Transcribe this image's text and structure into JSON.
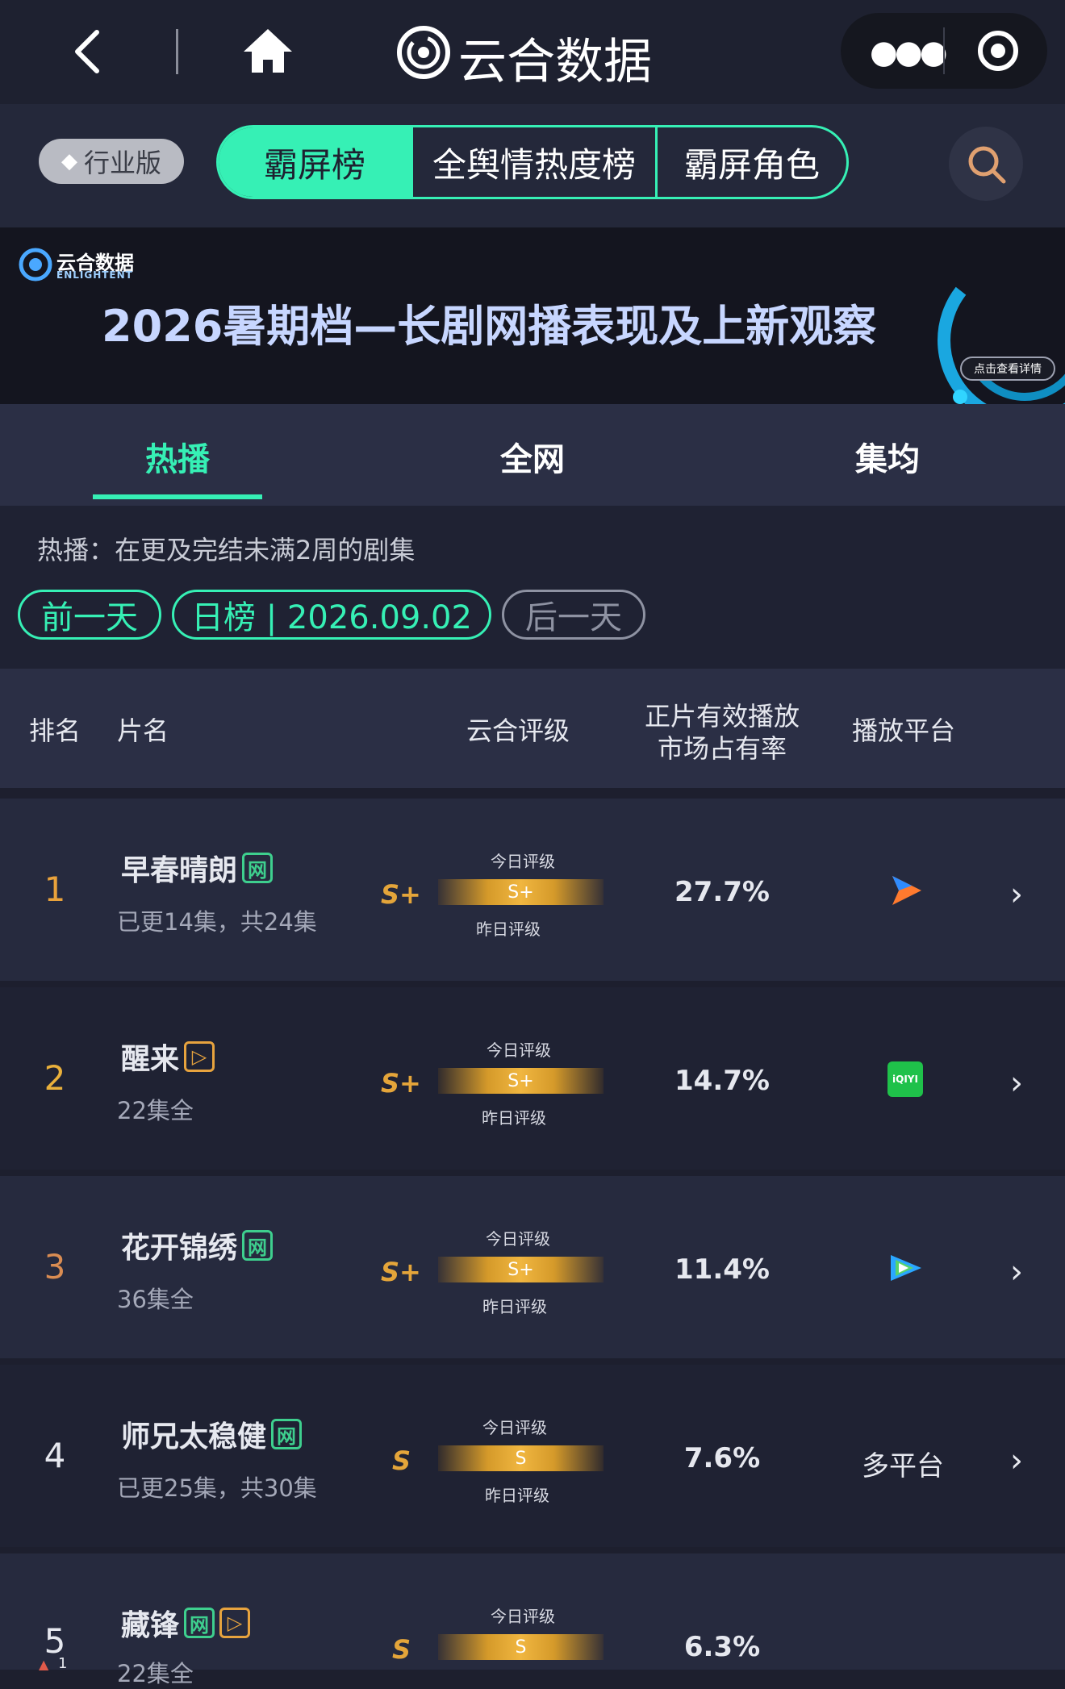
{
  "header": {
    "app_title": "云合数据",
    "icons": {
      "back": "back-chevron-icon",
      "home": "home-icon",
      "more": "more-dots-icon",
      "close": "target-circle-icon"
    }
  },
  "nav": {
    "edition_label": "行业版",
    "tabs": [
      {
        "label": "霸屏榜",
        "active": true
      },
      {
        "label": "全舆情热度榜",
        "active": false
      },
      {
        "label": "霸屏角色",
        "active": false
      }
    ],
    "accent": "#36f0b5"
  },
  "banner": {
    "logo_cn": "云合数据",
    "logo_en": "ENLIGHTENT",
    "headline": "2026暑期档—长剧网播表现及上新观察",
    "detail_button": "点击查看详情"
  },
  "subtabs": [
    {
      "label": "热播",
      "active": true
    },
    {
      "label": "全网",
      "active": false
    },
    {
      "label": "集均",
      "active": false
    }
  ],
  "info": {
    "description": "热播：在更及完结未满2周的剧集",
    "prev_day": "前一天",
    "date_label": "日榜 | 2026.09.02",
    "next_day": "后一天"
  },
  "table": {
    "headers": {
      "rank": "排名",
      "title": "片名",
      "grade": "云合评级",
      "share_line1": "正片有效播放",
      "share_line2": "市场占有率",
      "platform": "播放平台"
    },
    "grade_today_label": "今日评级",
    "grade_yesterday_label": "昨日评级",
    "rows": [
      {
        "rank": "1",
        "title": "早春晴朗",
        "badges": [
          "网"
        ],
        "sub": "已更14集，共24集",
        "grade": "S+",
        "bar_grade": "S+",
        "share": "27.7%",
        "platform": "tencent-video-icon",
        "platform_text": ""
      },
      {
        "rank": "2",
        "title": "醒来",
        "badges": [
          "▷"
        ],
        "sub": "22集全",
        "grade": "S+",
        "bar_grade": "S+",
        "share": "14.7%",
        "platform": "iqiyi-icon",
        "platform_text": "iQIYI"
      },
      {
        "rank": "3",
        "title": "花开锦绣",
        "badges": [
          "网"
        ],
        "sub": "36集全",
        "grade": "S+",
        "bar_grade": "S+",
        "share": "11.4%",
        "platform": "tencent-video-icon-2",
        "platform_text": ""
      },
      {
        "rank": "4",
        "title": "师兄太稳健",
        "badges": [
          "网"
        ],
        "sub": "已更25集，共30集",
        "grade": "S",
        "bar_grade": "S",
        "share": "7.6%",
        "platform": "multi-platform",
        "platform_text": "多平台"
      },
      {
        "rank": "5",
        "title": "藏锋",
        "badges": [
          "网",
          "▷"
        ],
        "sub": "22集全",
        "grade": "S",
        "bar_grade": "S",
        "share": "6.3%",
        "platform": "",
        "platform_text": "",
        "rank_change": "1"
      }
    ]
  },
  "colors": {
    "rank1": "#e9a23b",
    "rank2": "#e9b03b",
    "rank3": "#d98c52",
    "rank_default": "#e6e8ef",
    "grade": "#e4a53a"
  }
}
